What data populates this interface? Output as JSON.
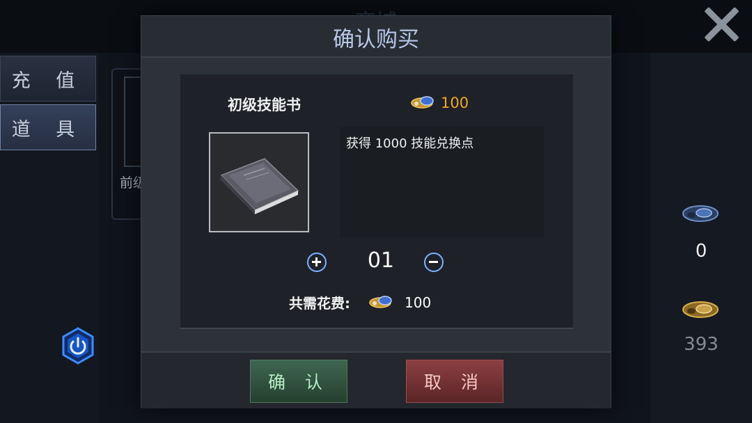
{
  "background": {
    "screen_title": "商城",
    "tabs": [
      {
        "label": "充 值"
      },
      {
        "label": "道 具"
      }
    ],
    "card_partial_name": "前级",
    "currency": [
      {
        "icon": "blue-gem-icon",
        "count": "0"
      },
      {
        "icon": "gold-gem-icon",
        "count": "393"
      }
    ]
  },
  "dialog": {
    "title": "确认购买",
    "item_name": "初级技能书",
    "price": "100",
    "price_icon": "gold-gem-icon",
    "description": "获得 1000 技能兑换点",
    "quantity": "01",
    "total_label": "共需花费:",
    "total_value": "100",
    "confirm_label": "确 认",
    "cancel_label": "取 消"
  },
  "colors": {
    "price": "#f5a623",
    "title": "#b7c7e8",
    "confirm_bg": "#3f6651",
    "cancel_bg": "#8c3f42",
    "accent_blue": "#7fb0ff"
  }
}
